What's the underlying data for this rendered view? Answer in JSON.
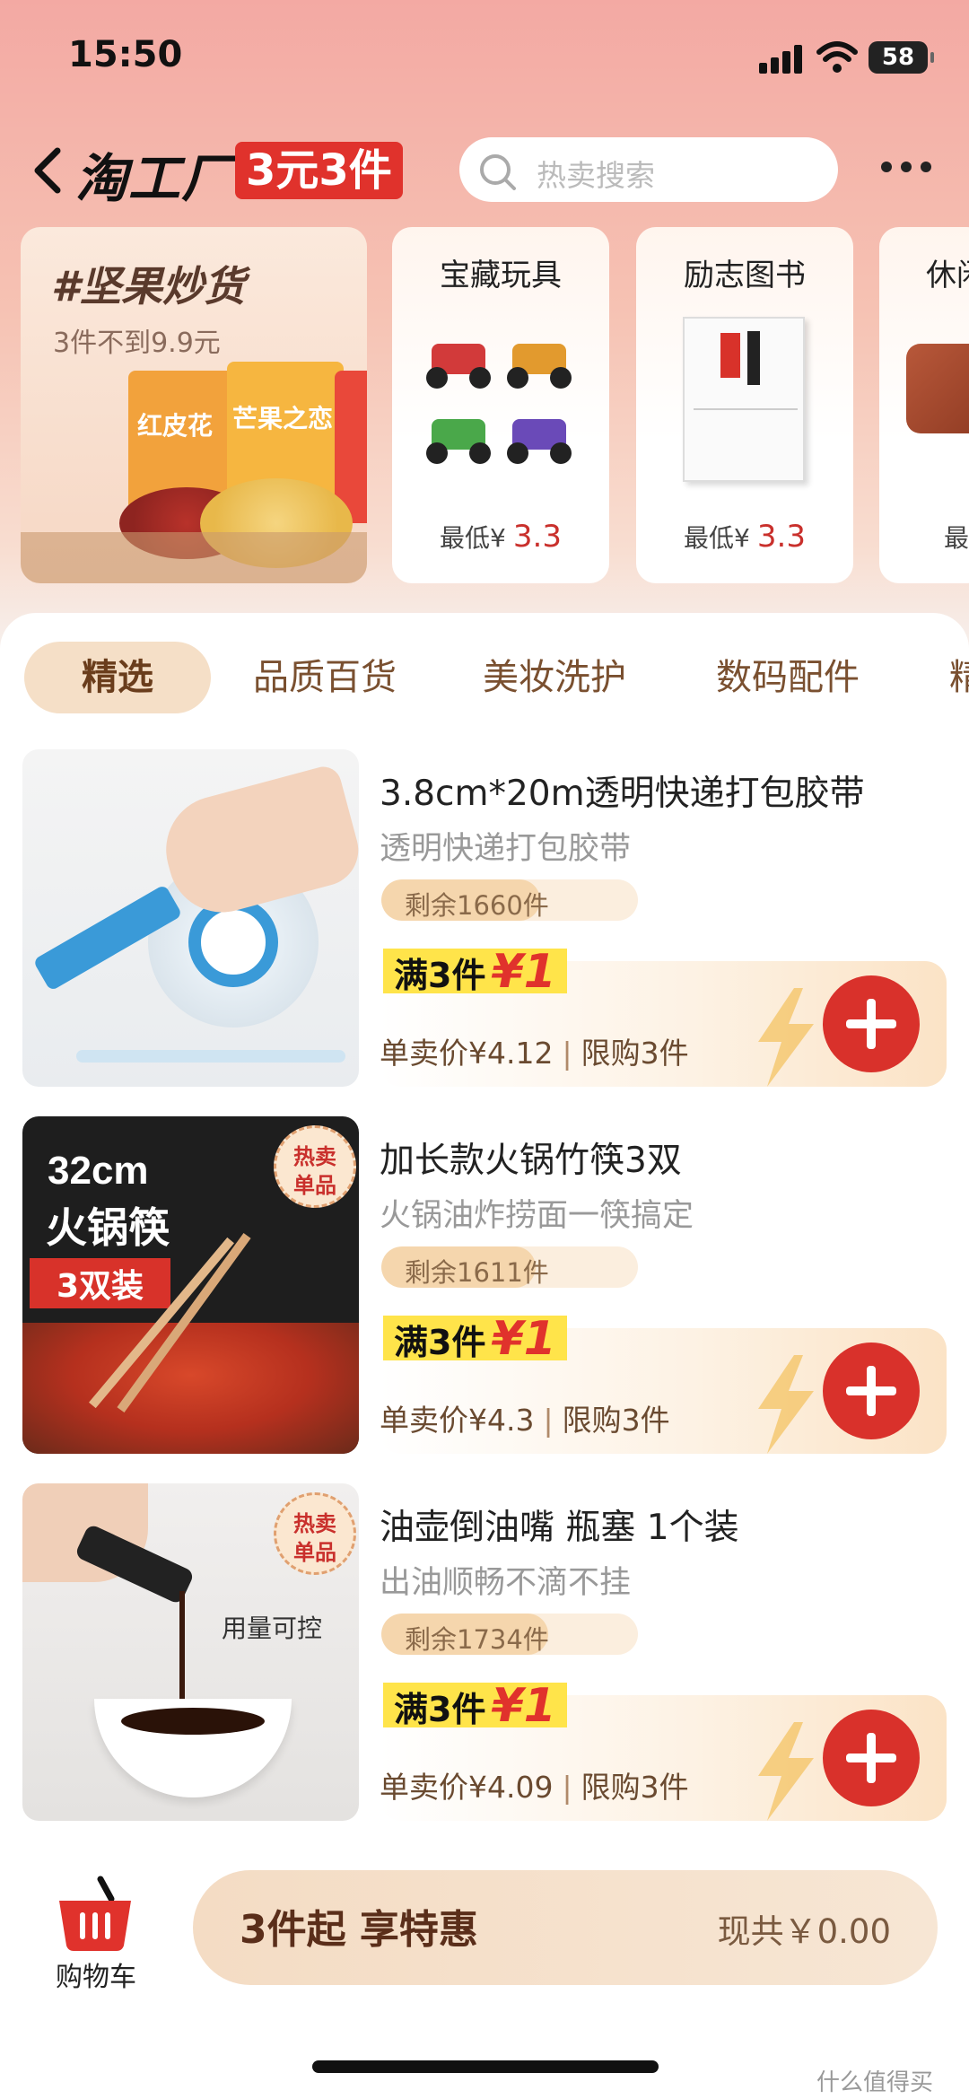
{
  "status": {
    "time": "15:50",
    "battery": "58"
  },
  "header": {
    "brand": "淘工厂",
    "badge": "3元3件",
    "search_placeholder": "热卖搜索"
  },
  "banner": {
    "title": "#坚果炒货",
    "subtitle": "3件不到9.9元",
    "bag_labels": [
      "红皮花",
      "芒果之恋"
    ]
  },
  "categories": [
    {
      "title": "宝藏玩具",
      "price_prefix": "最低¥",
      "price": "3.3"
    },
    {
      "title": "励志图书",
      "price_prefix": "最低¥",
      "price": "3.3"
    },
    {
      "title": "休闲",
      "price_prefix": "最",
      "price": ""
    }
  ],
  "tabs": [
    "精选",
    "品质百货",
    "美妆洗护",
    "数码配件",
    "精"
  ],
  "products": [
    {
      "title": "3.8cm*20m透明快递打包胶带",
      "subtitle": "透明快递打包胶带",
      "stock": "剩余1660件",
      "stock_fraction": 0.62,
      "deal_prefix": "满3件",
      "deal_price": "¥1",
      "single_price": "单卖价¥4.12",
      "limit": "限购3件"
    },
    {
      "title": "加长款火锅竹筷3双",
      "subtitle": "火锅油炸捞面一筷搞定",
      "stock": "剩余1611件",
      "stock_fraction": 0.6,
      "deal_prefix": "满3件",
      "deal_price": "¥1",
      "single_price": "单卖价¥4.3",
      "limit": "限购3件",
      "image_texts": [
        "32cm",
        "火锅筷",
        "3双装",
        "热卖",
        "单品"
      ]
    },
    {
      "title": "油壶倒油嘴 瓶塞 1个装",
      "subtitle": "出油顺畅不滴不挂",
      "stock": "剩余1734件",
      "stock_fraction": 0.65,
      "deal_prefix": "满3件",
      "deal_price": "¥1",
      "single_price": "单卖价¥4.09",
      "limit": "限购3件",
      "image_texts": [
        "热卖",
        "单品",
        "用量可控"
      ]
    }
  ],
  "bottom": {
    "cart_label": "购物车",
    "checkout_text": "3件起 享特惠",
    "total": "现共￥0.00"
  },
  "watermark": "什么值得买",
  "colors": {
    "accent_red": "#e0322c",
    "deal_yellow": "#ffe44a",
    "tab_active_bg": "#f5dfc7"
  }
}
